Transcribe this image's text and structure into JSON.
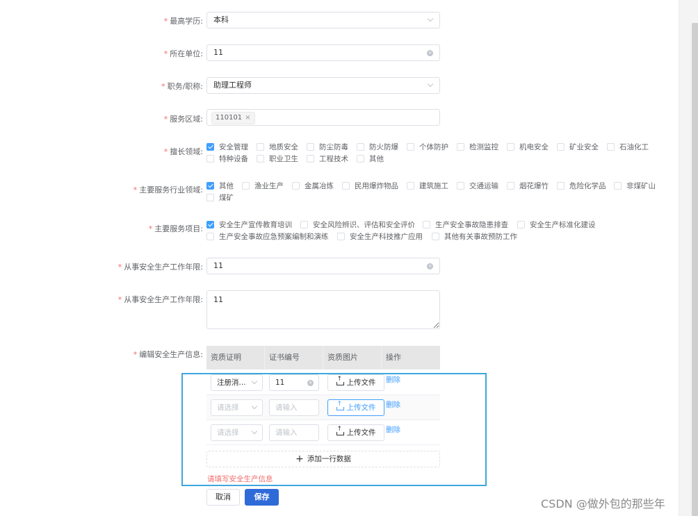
{
  "form": {
    "education": {
      "label": "最高学历:",
      "value": "本科"
    },
    "unit": {
      "label": "所在单位:",
      "value": "11"
    },
    "title": {
      "label": "职务/职称:",
      "value": "助理工程师"
    },
    "area": {
      "label": "服务区域:",
      "tag": "110101"
    },
    "expertise": {
      "label": "擅长领域:",
      "options": [
        {
          "text": "安全管理",
          "checked": true
        },
        {
          "text": "地质安全",
          "checked": false
        },
        {
          "text": "防尘防毒",
          "checked": false
        },
        {
          "text": "防火防爆",
          "checked": false
        },
        {
          "text": "个体防护",
          "checked": false
        },
        {
          "text": "检测监控",
          "checked": false
        },
        {
          "text": "机电安全",
          "checked": false
        },
        {
          "text": "矿业安全",
          "checked": false
        },
        {
          "text": "石油化工",
          "checked": false
        },
        {
          "text": "特种设备",
          "checked": false
        },
        {
          "text": "职业卫生",
          "checked": false
        },
        {
          "text": "工程技术",
          "checked": false
        },
        {
          "text": "其他",
          "checked": false
        }
      ]
    },
    "industry": {
      "label": "主要服务行业领域:",
      "options": [
        {
          "text": "其他",
          "checked": true
        },
        {
          "text": "渔业生产",
          "checked": false
        },
        {
          "text": "金属冶炼",
          "checked": false
        },
        {
          "text": "民用爆炸物品",
          "checked": false
        },
        {
          "text": "建筑施工",
          "checked": false
        },
        {
          "text": "交通运输",
          "checked": false
        },
        {
          "text": "烟花爆竹",
          "checked": false
        },
        {
          "text": "危险化学品",
          "checked": false
        },
        {
          "text": "非煤矿山",
          "checked": false
        },
        {
          "text": "煤矿",
          "checked": false
        }
      ]
    },
    "projects": {
      "label": "主要服务项目:",
      "options": [
        {
          "text": "安全生产宣传教育培训",
          "checked": true
        },
        {
          "text": "安全风险辨识、评估和安全评价",
          "checked": false
        },
        {
          "text": "生产安全事故隐患排查",
          "checked": false
        },
        {
          "text": "安全生产标准化建设",
          "checked": false
        },
        {
          "text": "生产安全事故应急预案编制和演练",
          "checked": false
        },
        {
          "text": "安全生产科技推广应用",
          "checked": false
        },
        {
          "text": "其他有关事故预防工作",
          "checked": false
        }
      ]
    },
    "years": {
      "label": "从事安全生产工作年限:",
      "value": "11"
    },
    "years2": {
      "label": "从事安全生产工作年限:",
      "value": "11"
    },
    "safety_info": {
      "label": "编辑安全生产信息:",
      "columns": [
        "资质证明",
        "证书编号",
        "资质图片",
        "操作"
      ],
      "rows": [
        {
          "select": "注册消...",
          "select_placeholder": false,
          "number": "11",
          "number_placeholder": false,
          "upload": "上传文件",
          "delete": "删除"
        },
        {
          "select": "请选择",
          "select_placeholder": true,
          "number": "请输入",
          "number_placeholder": true,
          "upload": "上传文件",
          "delete": "删除"
        },
        {
          "select": "请选择",
          "select_placeholder": true,
          "number": "请输入",
          "number_placeholder": true,
          "upload": "上传文件",
          "delete": "删除"
        }
      ],
      "add_row": "添加一行数据",
      "error": "请填写安全生产信息"
    }
  },
  "buttons": {
    "cancel": "取消",
    "save": "保存"
  },
  "watermark": "CSDN @做外包的那些年",
  "colors": {
    "primary": "#409eff",
    "save": "#2f6bd8",
    "required": "#f56c6c",
    "highlight": "#3ea6dd"
  }
}
